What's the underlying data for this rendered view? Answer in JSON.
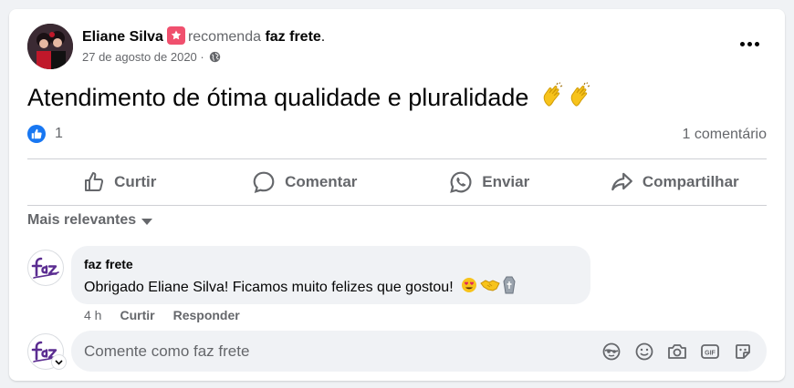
{
  "post": {
    "author": "Eliane Silva",
    "verb": "recomenda",
    "target": "faz frete",
    "target_suffix": ".",
    "date": "27 de agosto de 2020",
    "date_sep": " · ",
    "text": "Atendimento de ótima qualidade e pluralidade",
    "like_count": "1",
    "comment_count": "1 comentário"
  },
  "actions": {
    "like": "Curtir",
    "comment": "Comentar",
    "send": "Enviar",
    "share": "Compartilhar"
  },
  "sort_label": "Mais relevantes",
  "comment": {
    "author": "faz frete",
    "text": "Obrigado Eliane Silva! Ficamos muito felizes que gostou!",
    "time": "4 h",
    "like": "Curtir",
    "reply": "Responder"
  },
  "composer": {
    "placeholder": "Comente como faz frete"
  },
  "icons": {
    "recommend": "recommend-star-icon",
    "privacy": "globe-icon",
    "more": "more-options-icon",
    "reaction": "like-reaction-icon",
    "emoji_post": "clapping-hands-icon",
    "emoji_comment": [
      "heart-eyes-icon",
      "handshake-icon",
      "coffin-icon"
    ],
    "tools": [
      "avatar-sticker-icon",
      "emoji-icon",
      "camera-icon",
      "gif-icon",
      "sticker-icon"
    ]
  },
  "colors": {
    "brand_blue": "#1877f2",
    "recommend_pink": "#f0506e",
    "secondary_text": "#65676b",
    "logo_purple": "#5b2d91"
  }
}
